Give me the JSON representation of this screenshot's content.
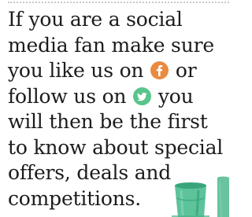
{
  "promo": {
    "line1": "If you are a social",
    "line2": "media fan make sure",
    "line3_before": "you like us on ",
    "line3_after": " or",
    "line4_before": "follow us on ",
    "line4_after": " you",
    "line5": "will then be the first",
    "line6": "to know about special",
    "line7": "offers, deals and",
    "line8": "competitions."
  },
  "icons": {
    "facebook": "facebook-icon",
    "twitter": "twitter-icon",
    "decoration": "cups-illustration"
  },
  "colors": {
    "text": "#1c1c1c",
    "facebook_accent": "#ea8a3f",
    "twitter_accent": "#58c58a",
    "cups": "#5cc39b"
  }
}
